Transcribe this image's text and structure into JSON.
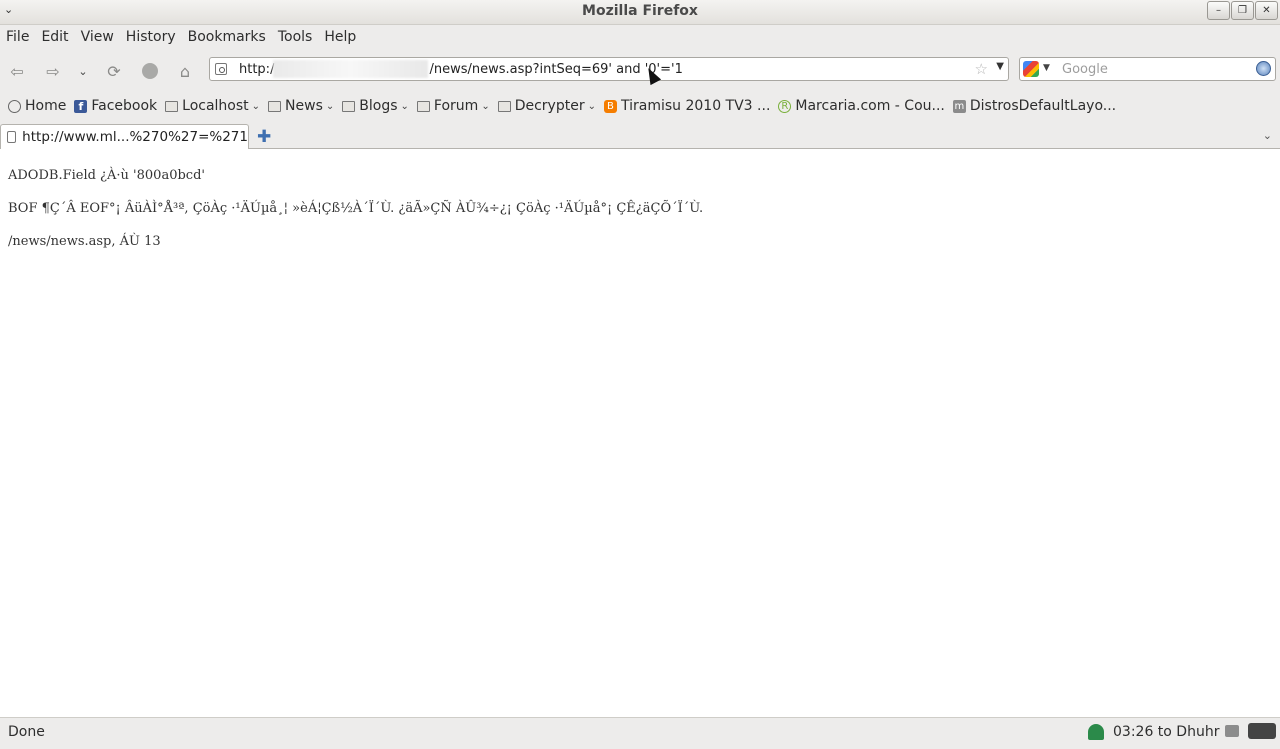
{
  "window": {
    "title": "Mozilla Firefox",
    "controls": [
      "minimize",
      "maximize",
      "close"
    ]
  },
  "menubar": [
    "File",
    "Edit",
    "View",
    "History",
    "Bookmarks",
    "Tools",
    "Help"
  ],
  "navigation": {
    "buttons": [
      "back-icon",
      "forward-icon",
      "history-dropdown-icon",
      "reload-icon",
      "stop-icon",
      "home-icon"
    ],
    "url": "http://                         /news/news.asp?intSeq=69' and '0'='1",
    "url_visible": "http:/",
    "url_rest": "/news/news.asp?intSeq=69' and '0'='1"
  },
  "search": {
    "placeholder": "Google"
  },
  "bookmarks": [
    {
      "label": "Home",
      "icon": "globe-icon",
      "has_menu": false
    },
    {
      "label": "Facebook",
      "icon": "facebook-icon",
      "has_menu": false
    },
    {
      "label": "Localhost",
      "icon": "folder-icon",
      "has_menu": true
    },
    {
      "label": "News",
      "icon": "folder-icon",
      "has_menu": true
    },
    {
      "label": "Blogs",
      "icon": "folder-icon",
      "has_menu": true
    },
    {
      "label": "Forum",
      "icon": "folder-icon",
      "has_menu": true
    },
    {
      "label": "Decrypter",
      "icon": "folder-icon",
      "has_menu": true
    },
    {
      "label": "Tiramisu 2010 TV3 ...",
      "icon": "blogger-icon",
      "has_menu": false
    },
    {
      "label": "Marcaria.com - Cou...",
      "icon": "marcaria-icon",
      "has_menu": false
    },
    {
      "label": "DistrosDefaultLayo...",
      "icon": "m-icon",
      "has_menu": false
    }
  ],
  "tabs": [
    {
      "label": "http://www.ml...%270%27=%271"
    }
  ],
  "page": {
    "lines": [
      "ADODB.Field ¿À·ù '800a0bcd'",
      "BOF ¶Ç´Â EOF°¡ ÂüÀÌ°Å³ª, ÇöÀç ·¹ÄÚµå¸¦ »èÁ¦Çß½À´Ï´Ù. ¿äÃ»ÇÑ ÀÛ¾÷¿¡ ÇöÀç ·¹ÄÚµå°¡ ÇÊ¿äÇÕ´Ï´Ù.",
      "/news/news.asp, ÁÙ 13"
    ]
  },
  "statusbar": {
    "status": "Done",
    "prayer": "03:26 to Dhuhr"
  }
}
